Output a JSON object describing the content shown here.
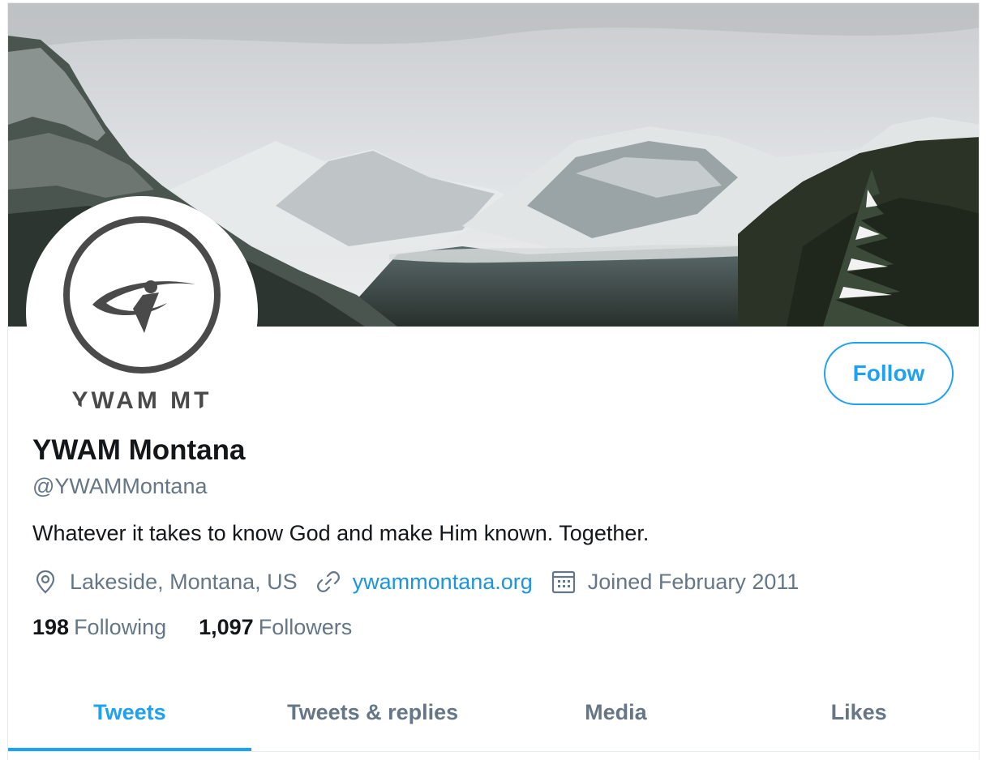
{
  "profile": {
    "name": "YWAM Montana",
    "handle": "@YWAMMontana",
    "bio": "Whatever it takes to know God and make Him known. Together.",
    "location": "Lakeside, Montana, US",
    "website": "ywammontana.org",
    "joined": "Joined February 2011",
    "avatar_text": "YWAM MT"
  },
  "actions": {
    "follow_label": "Follow"
  },
  "stats": {
    "following_count": "198",
    "following_label": "Following",
    "followers_count": "1,097",
    "followers_label": "Followers"
  },
  "tabs": [
    {
      "label": "Tweets",
      "active": true
    },
    {
      "label": "Tweets & replies",
      "active": false
    },
    {
      "label": "Media",
      "active": false
    },
    {
      "label": "Likes",
      "active": false
    }
  ],
  "icons": {
    "location": "location-pin-icon",
    "website": "link-icon",
    "joined": "calendar-icon"
  },
  "colors": {
    "accent": "#1da1f2",
    "link": "#1b95e0",
    "secondary_text": "#657786",
    "primary_text": "#14171a",
    "logo_gray": "#4a4a4a"
  }
}
